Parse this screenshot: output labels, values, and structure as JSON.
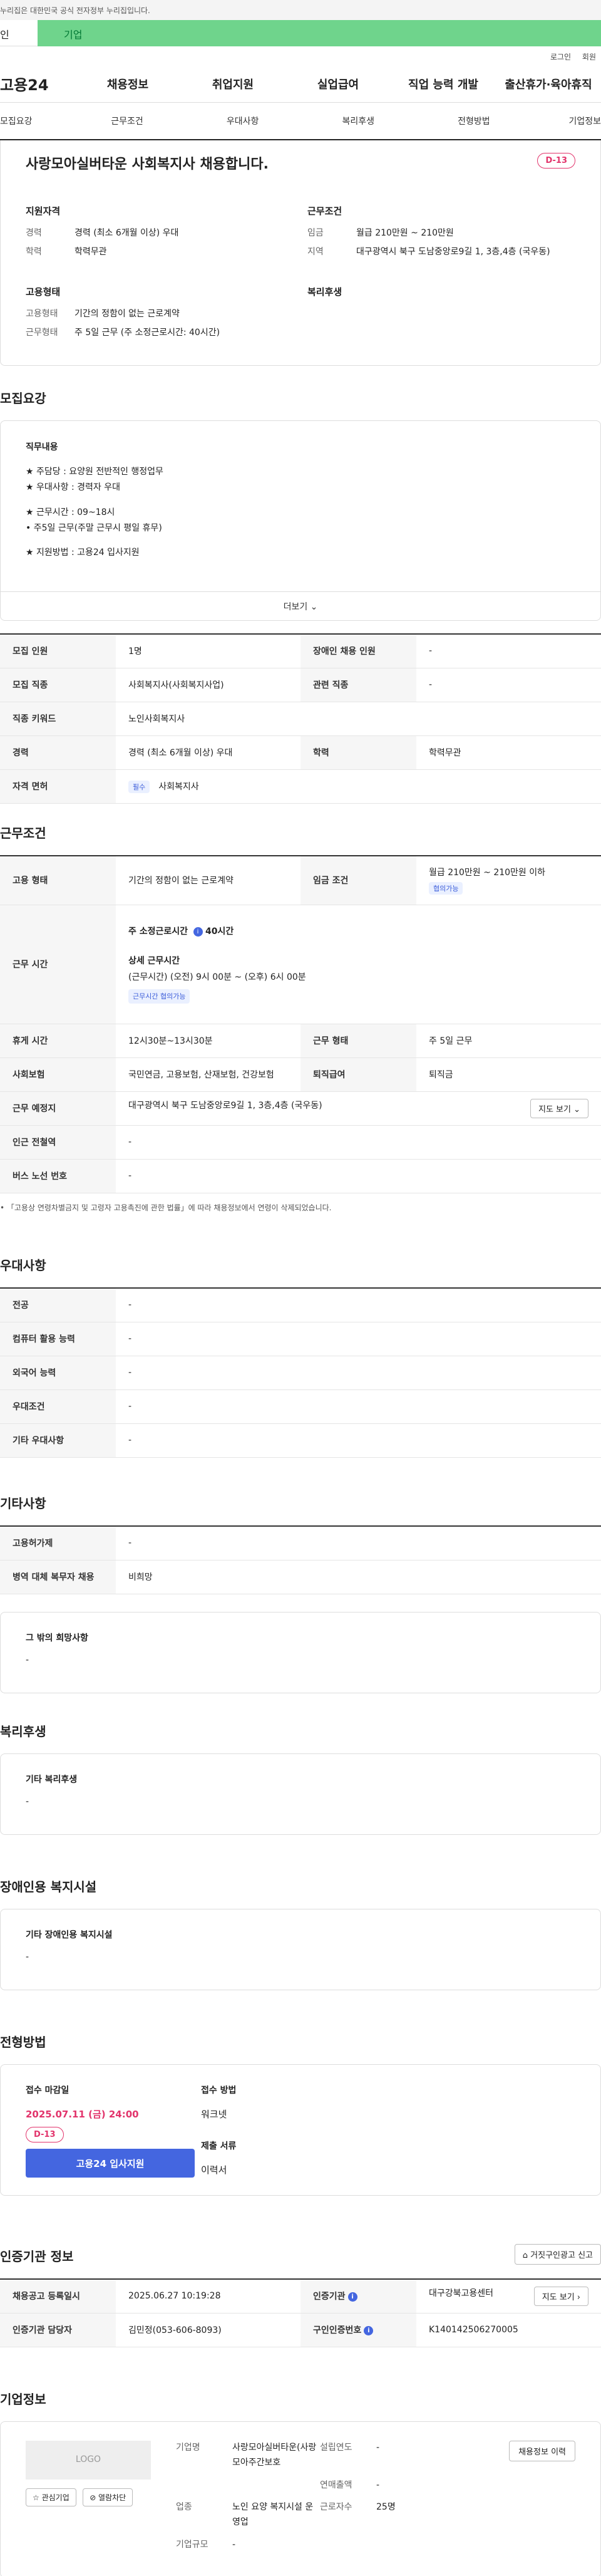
{
  "gov_bar": "누리집은 대한민국 공식 전자정부 누리집입니다.",
  "tabs": {
    "personal": "인",
    "company": "기업"
  },
  "util": {
    "login": "로그인",
    "join": "회원"
  },
  "logo": "고용24",
  "gnb": [
    "채용정보",
    "취업지원",
    "실업급여",
    "직업 능력 개발",
    "출산휴가·육아휴직"
  ],
  "subnav": [
    "모집요강",
    "근무조건",
    "우대사항",
    "복리후생",
    "전형방법",
    "기업정보"
  ],
  "summary": {
    "title": "사랑모아실버타운 사회복지사 채용합니다.",
    "dday": "D-13",
    "qualification_head": "지원자격",
    "career_label": "경력",
    "career_value": "경력 (최소 6개월 이상) 우대",
    "edu_label": "학력",
    "edu_value": "학력무관",
    "workcond_head": "근무조건",
    "wage_label": "임금",
    "wage_value": "월급 210만원 ~ 210만원",
    "region_label": "지역",
    "region_value": "대구광역시 북구 도남중앙로9길 1, 3층,4층 (국우동)",
    "employ_head": "고용형태",
    "type_label": "고용형태",
    "type_value": "기간의 정함이 없는 근로계약",
    "worktype_label": "근무형태",
    "worktype_value": "주 5일 근무 (주 소정근로시간: 40시간)",
    "welfare_head": "복리후생"
  },
  "recruit": {
    "title": "모집요강",
    "duty_head": "직무내용",
    "duty_lines": [
      "★ 주담당 : 요양원 전반적인 행정업무",
      "★ 우대사항 : 경력자 우대",
      "★ 근무시간 : 09~18시",
      "• 주5일 근무(주말 근무시 평일 휴무)",
      "★ 지원방법 : 고용24 입사지원"
    ],
    "more": "더보기 ⌄",
    "rows": {
      "count_k": "모집 인원",
      "count_v": "1명",
      "disabled_k": "장애인 채용 인원",
      "disabled_v": "-",
      "job_k": "모집 직종",
      "job_v": "사회복지사(사회복지사업)",
      "related_k": "관련 직종",
      "related_v": "-",
      "keyword_k": "직종 키워드",
      "keyword_v": "노인사회복지사",
      "exp_k": "경력",
      "exp_v": "경력 (최소 6개월 이상) 우대",
      "edu_k": "학력",
      "edu_v": "학력무관",
      "license_k": "자격 면허",
      "license_badge": "필수",
      "license_v": "사회복지사"
    }
  },
  "workcond": {
    "title": "근무조건",
    "emp_k": "고용 형태",
    "emp_v": "기간의 정함이 없는 근로계약",
    "wage_k": "임금 조건",
    "wage_v": "월급 210만원 ~ 210만원 이하",
    "wage_badge": "협의가능",
    "hours_k": "근무 시간",
    "hours_total": "주 소정근로시간",
    "hours_total_v": "40시간",
    "hours_detail_head": "상세 근무시간",
    "hours_detail": "(근무시간) (오전) 9시 00분 ~ (오후) 6시 00분",
    "hours_badge": "근무시간 협의가능",
    "break_k": "휴게 시간",
    "break_v": "12시30분~13시30분",
    "worktype_k": "근무 형태",
    "worktype_v": "주 5일 근무",
    "ins_k": "사회보험",
    "ins_v": "국민연금, 고용보험, 산재보험, 건강보험",
    "retire_k": "퇴직급여",
    "retire_v": "퇴직금",
    "place_k": "근무 예정지",
    "place_v": "대구광역시 북구 도남중앙로9길 1, 3층,4층 (국우동)",
    "map_btn": "지도 보기 ⌄",
    "subway_k": "인근 전철역",
    "subway_v": "-",
    "bus_k": "버스 노선 번호",
    "bus_v": "-",
    "note": "• 「고용상 연령차별금지 및 고령자 고용촉진에 관한 법률」에 따라 채용정보에서 연령이 삭제되었습니다."
  },
  "prefer": {
    "title": "우대사항",
    "rows": [
      [
        "전공",
        "-"
      ],
      [
        "컴퓨터 활용 능력",
        "-"
      ],
      [
        "외국어 능력",
        "-"
      ],
      [
        "우대조건",
        "-"
      ],
      [
        "기타 우대사항",
        "-"
      ]
    ]
  },
  "etc": {
    "title": "기타사항",
    "rows": [
      [
        "고용허가제",
        "-"
      ],
      [
        "병역 대체 복무자 채용",
        "비희망"
      ]
    ],
    "box_head": "그 밖의 희망사항",
    "box_v": "-"
  },
  "welfare": {
    "title": "복리후생",
    "box_head": "기타 복리후생",
    "box_v": "-"
  },
  "disabled": {
    "title": "장애인용 복지시설",
    "box_head": "기타 장애인용 복지시설",
    "box_v": "-"
  },
  "selection": {
    "title": "전형방법",
    "deadline_head": "접수 마감일",
    "deadline": "2025.07.11 (금) 24:00",
    "dday": "D-13",
    "apply_btn": "고용24 입사지원",
    "method_head": "접수 방법",
    "method_v": "워크넷",
    "docs_head": "제출 서류",
    "docs_v": "이력서"
  },
  "cert": {
    "title": "인증기관 정보",
    "report_btn": "⌂ 거짓구인광고 신고",
    "reg_k": "채용공고 등록일시",
    "reg_v": "2025.06.27 10:19:28",
    "org_k": "인증기관",
    "org_v": "대구강북고용센터",
    "map_btn": "지도 보기 ›",
    "manager_k": "인증기관 담당자",
    "manager_v": "김민정(053-606-8093)",
    "id_k": "구인인증번호",
    "id_v": "K140142506270005"
  },
  "company": {
    "title": "기업정보",
    "logo": "LOGO",
    "fav_btn": "☆ 관심기업",
    "block_btn": "⊘ 열람차단",
    "corp_btn": "채용정보 이력",
    "name_k": "기업명",
    "name_v": "사랑모아실버타운(사랑모아주간보호",
    "year_k": "설립연도",
    "year_v": "-",
    "sales_k": "연매출액",
    "sales_v": "-",
    "industry_k": "업종",
    "industry_v": "노인 요양 복지시설 운영업",
    "emp_k": "근로자수",
    "emp_v": "25명",
    "size_k": "기업규모",
    "size_v": "-"
  }
}
